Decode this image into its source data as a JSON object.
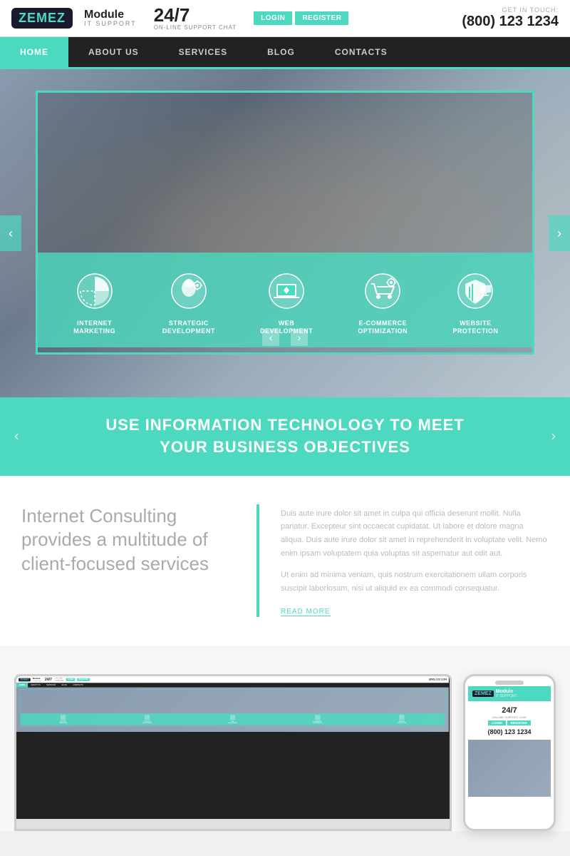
{
  "brand": {
    "zemez": "ZEMEZ",
    "module": "Module",
    "it_support": "IT SUPPORT",
    "support_247": "24/7",
    "support_sub": "ON-LINE SUPPORT CHAT"
  },
  "header": {
    "login": "LOGIN",
    "register": "REGISTER",
    "get_in_touch": "GET IN TOUCH:",
    "phone": "(800) 123 1234"
  },
  "nav": {
    "items": [
      {
        "label": "HOME",
        "active": true
      },
      {
        "label": "ABOUT US",
        "active": false
      },
      {
        "label": "SERVICES",
        "active": false
      },
      {
        "label": "BLOG",
        "active": false
      },
      {
        "label": "CONTACTS",
        "active": false
      }
    ]
  },
  "hero": {
    "icons": [
      {
        "label": "INTERNET\nMARKETING",
        "icon": "chart-icon"
      },
      {
        "label": "STRATEGIC\nDEVELOPMENT",
        "icon": "brain-icon"
      },
      {
        "label": "WEB\nDEVELOPMENT",
        "icon": "laptop-icon"
      },
      {
        "label": "E-COMMERCE\nOPTIMIZATION",
        "icon": "cart-icon"
      },
      {
        "label": "WEBSITE\nPROTECTION",
        "icon": "shield-icon"
      }
    ],
    "prev_label": "‹",
    "next_label": "›",
    "arrow_left": "‹",
    "arrow_right": "›"
  },
  "tagline": {
    "line1": "USE INFORMATION TECHNOLOGY TO MEET",
    "line2": "YOUR BUSINESS OBJECTIVES",
    "arrow_left": "‹",
    "arrow_right": "›"
  },
  "content": {
    "heading": "Internet Consulting provides a multitude of client-focused services",
    "body1": "Duis aute irure dolor sit amet in culpa qui officia deserunt mollit. Nulla pariatur. Excepteur sint occaecat cupidatat. Ut labore et dolore magna aliqua. Duis aute irure dolor sit amet in reprehenderit in voluptate velit. Nemo enim ipsam voluptatem quia voluptas sit aspernatur aut odit aut.",
    "body2": "Ut enim ad minima veniam, quis nostrum exercitationem ullam corporis suscipit laboriosam, nisi ut aliquid ex ea commodi consequatur.",
    "read_more": "READ MORE"
  },
  "mockup": {
    "laptop_brand": "Module",
    "laptop_it": "IT SUPPORT",
    "laptop_247": "24/7",
    "laptop_phone": "(800) 123 1234",
    "phone_brand": "Module",
    "phone_it": "IT SUPPORT",
    "phone_247": "24/7",
    "phone_sub": "ON-LINE SUPPORT CHAT",
    "phone_login": "LOGIN",
    "phone_register": "REGISTER",
    "phone_phone": "(800) 123 1234"
  }
}
